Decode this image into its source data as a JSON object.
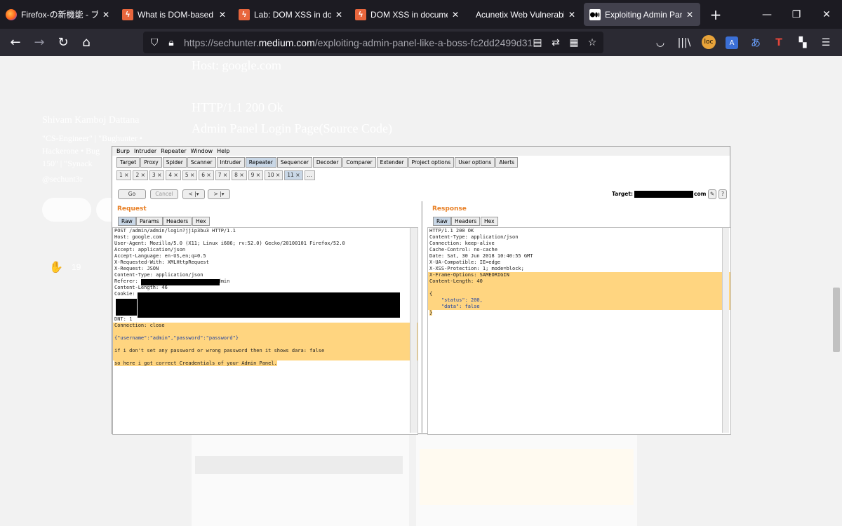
{
  "browser": {
    "tabs": [
      {
        "title": "Firefox-の新機能 - ブラ",
        "icon": "firefox-icon"
      },
      {
        "title": "What is DOM-based XS",
        "icon": "portswigger-icon"
      },
      {
        "title": "Lab: DOM XSS in docu",
        "icon": "portswigger-icon"
      },
      {
        "title": "DOM XSS in document",
        "icon": "portswigger-icon"
      },
      {
        "title": "Acunetix Web Vulnerability",
        "icon": "none"
      },
      {
        "title": "Exploiting Admin Pane",
        "icon": "medium-icon"
      }
    ],
    "url_prefix": "https://sechunter.",
    "url_domain": "medium.com",
    "url_path": "/exploiting-admin-panel-like-a-boss-fc2dd2499d31"
  },
  "article": {
    "host_line": "Host: google.com",
    "http_line": "HTTP/1.1 200 Ok",
    "caption": "Admin Panel Login Page(Source Code)",
    "author_name": "Shivam Kamboj Dattana",
    "author_bio1": "\"CS-Engineer\" | \"Bughunter •",
    "author_bio2": "Hackerone • Bug",
    "author_bio3": "150\" | \"Synack",
    "author_handle": "@sechunt3r",
    "follow_label": "Follow",
    "clap_count": "19"
  },
  "burp": {
    "menu": [
      "Burp",
      "Intruder",
      "Repeater",
      "Window",
      "Help"
    ],
    "tools": [
      "Target",
      "Proxy",
      "Spider",
      "Scanner",
      "Intruder",
      "Repeater",
      "Sequencer",
      "Decoder",
      "Comparer",
      "Extender",
      "Project options",
      "User options",
      "Alerts"
    ],
    "repeater_tabs": [
      "1",
      "2",
      "3",
      "4",
      "5",
      "6",
      "7",
      "8",
      "9",
      "10",
      "11",
      "..."
    ],
    "go_label": "Go",
    "cancel_label": "Cancel",
    "back_label": "< |▾",
    "fwd_label": "> |▾",
    "target_label": "Target:",
    "target_suffix": "com",
    "request_label": "Request",
    "response_label": "Response",
    "request_tabs": [
      "Raw",
      "Params",
      "Headers",
      "Hex"
    ],
    "response_tabs": [
      "Raw",
      "Headers",
      "Hex"
    ],
    "request_lines": [
      "POST /admin/admin/login?jjip3bu3 HTTP/1.1",
      "Host: google.com",
      "User-Agent: Mozilla/5.0 (X11; Linux i686; rv:52.0) Gecko/20100101 Firefox/52.0",
      "Accept: application/json",
      "Accept-Language: en-US,en;q=0.5",
      "X-Requested-With: XMLHttpRequest",
      "X-Request: JSON",
      "Content-Type: application/json",
      "Referer:                         /admin",
      "Content-Length: 46",
      "Cookie:",
      "",
      "",
      "",
      "DNT: 1",
      "Connection: close",
      "",
      "{\"username\":\"admin\",\"password\":\"password\"}",
      "",
      "if i don't set any password or wrong password then it shows dara: false",
      "",
      "so here i got correct Creadentials of your Admin Panel."
    ],
    "response_lines": [
      "HTTP/1.1 200 OK",
      "Content-Type: application/json",
      "Connection: keep-alive",
      "Cache-Control: no-cache",
      "Date: Sat, 30 Jun 2018 10:40:55 GMT",
      "X-UA-Compatible: IE=edge",
      "X-XSS-Protection: 1; mode=block;",
      "X-Frame-Options: SAMEORIGIN",
      "Content-Length: 40",
      "",
      "{",
      "    \"status\": 200,",
      "    \"data\": false",
      "}"
    ]
  }
}
